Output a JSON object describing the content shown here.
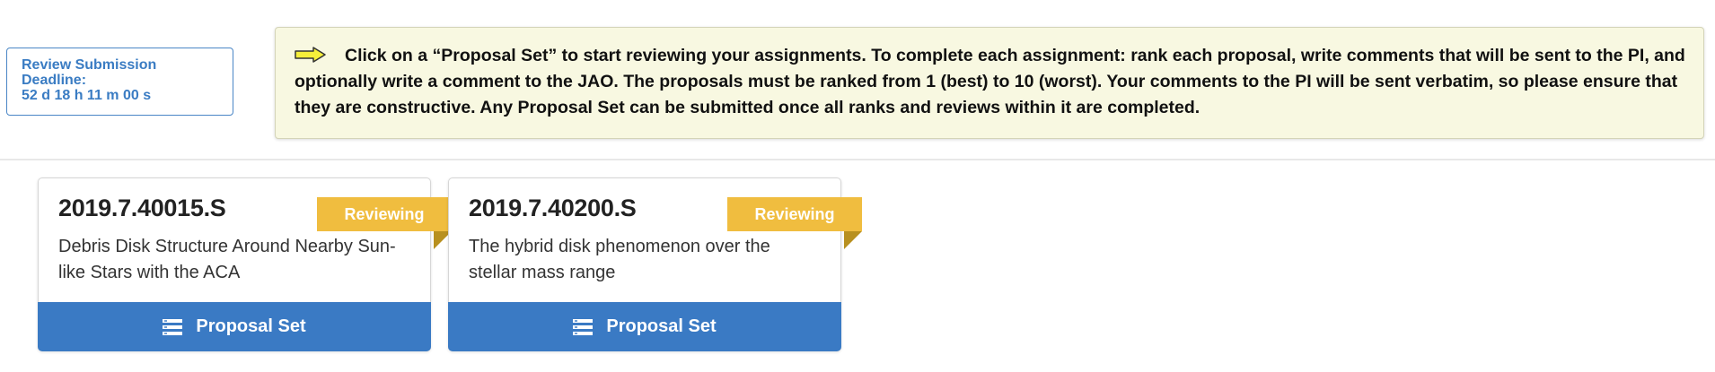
{
  "deadline": {
    "label_line1": "Review Submission",
    "label_line2": "Deadline:",
    "countdown": "52 d 18 h 11 m 00 s"
  },
  "info": {
    "icon": "right-arrow-icon",
    "line1": "Click on a “Proposal Set” to start reviewing your assignments. To complete each assignment: rank each proposal, write comments that will be sent to the PI, and",
    "line2": "optionally write a comment to the JAO. The proposals must be ranked from 1 (best) to 10 (worst). Your comments to the PI will be sent verbatim, so please ensure that",
    "line3": "they are constructive. Any Proposal Set can be submitted once all ranks and reviews within it are completed."
  },
  "cards": [
    {
      "code": "2019.7.40015.S",
      "status": "Reviewing",
      "desc_line1": "Debris Disk Structure Around Nearby Sun-",
      "desc_line2": "like Stars with the ACA",
      "button_label": "Proposal Set"
    },
    {
      "code": "2019.7.40200.S",
      "status": "Reviewing",
      "desc_line1": "The hybrid disk phenomenon over the",
      "desc_line2": "stellar mass range",
      "button_label": "Proposal Set"
    }
  ],
  "colors": {
    "accent_blue": "#3a7ac4",
    "ribbon_yellow": "#f0bd3f",
    "info_background": "#f8f8e1"
  }
}
